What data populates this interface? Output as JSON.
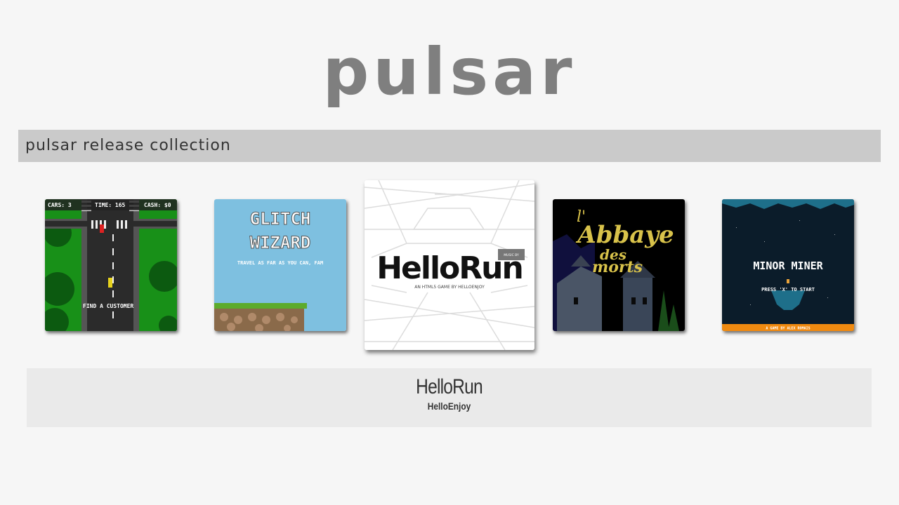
{
  "app": {
    "logo_text": "pulsar"
  },
  "collection": {
    "title": "pulsar release collection"
  },
  "games": [
    {
      "name": "taxi-game",
      "hud": {
        "cars": "CARS: 3",
        "time": "TIME: 165",
        "cash": "CASH: $0"
      },
      "caption": "FIND A CUSTOMER"
    },
    {
      "name": "glitch-wizard",
      "title_line1": "GLITCH",
      "title_line2": "WIZARD",
      "tagline": "TRAVEL AS FAR AS YOU CAN, FAM"
    },
    {
      "name": "hellorun",
      "logo": "HelloRun",
      "subtitle": "AN HTML5 GAME BY HELLOENJOY",
      "badge": "MUSIC BY"
    },
    {
      "name": "abbaye",
      "title_l": "l'",
      "title_line1": "Abbaye",
      "title_line2": "des",
      "title_line3": "morts"
    },
    {
      "name": "minor-miner",
      "title": "MINOR MINER",
      "prompt": "PRESS 'X' TO START",
      "footer": "A GAME BY ALEX ROMAIS"
    }
  ],
  "selected": {
    "title": "HelloRun",
    "author": "HelloEnjoy"
  },
  "colors": {
    "background": "#f6f6f6",
    "bar": "#cacaca",
    "logo": "#7f7f7f",
    "info_box": "#eaeaea"
  }
}
